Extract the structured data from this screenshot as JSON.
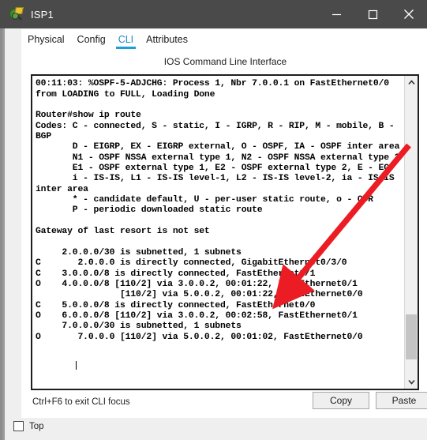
{
  "window": {
    "title": "ISP1",
    "icon": "packet-tracer-device-icon",
    "controls": {
      "minimize": "minimize-icon",
      "maximize": "maximize-icon",
      "close": "close-icon"
    }
  },
  "tabs": [
    {
      "label": "Physical",
      "active": false
    },
    {
      "label": "Config",
      "active": false
    },
    {
      "label": "CLI",
      "active": true
    },
    {
      "label": "Attributes",
      "active": false
    }
  ],
  "panel": {
    "title": "IOS Command Line Interface"
  },
  "terminal": {
    "text": "Router#\n00:11:03: %OSPF-5-ADJCHG: Process 1, Nbr 7.0.0.1 on FastEthernet0/0\nfrom LOADING to FULL, Loading Done\n\nRouter#show ip route\nCodes: C - connected, S - static, I - IGRP, R - RIP, M - mobile, B -\nBGP\n       D - EIGRP, EX - EIGRP external, O - OSPF, IA - OSPF inter area\n       N1 - OSPF NSSA external type 1, N2 - OSPF NSSA external type 2\n       E1 - OSPF external type 1, E2 - OSPF external type 2, E - EGP\n       i - IS-IS, L1 - IS-IS level-1, L2 - IS-IS level-2, ia - IS-IS\ninter area\n       * - candidate default, U - per-user static route, o - ODR\n       P - periodic downloaded static route\n\nGateway of last resort is not set\n\n     2.0.0.0/30 is subnetted, 1 subnets\nC       2.0.0.0 is directly connected, GigabitEthernet0/3/0\nC    3.0.0.0/8 is directly connected, FastEthernet0/1\nO    4.0.0.0/8 [110/2] via 3.0.0.2, 00:01:22, FastEthernet0/1\n                [110/2] via 5.0.0.2, 00:01:22, FastEthernet0/0\nC    5.0.0.0/8 is directly connected, FastEthernet0/0\nO    6.0.0.0/8 [110/2] via 3.0.0.2, 00:02:58, FastEthernet0/1\n     7.0.0.0/30 is subnetted, 1 subnets\nO       7.0.0.0 [110/2] via 5.0.0.2, 00:01:02, FastEthernet0/0\n",
    "prompt": "Router#",
    "scrollbar": {
      "up_icon": "chevron-up-icon",
      "down_icon": "chevron-down-icon"
    }
  },
  "footer": {
    "hint": "Ctrl+F6 to exit CLI focus",
    "copy_label": "Copy",
    "paste_label": "Paste"
  },
  "top_option": {
    "label": "Top",
    "checked": false
  },
  "annotation": {
    "arrow_color": "#ec1c24",
    "target_text": "FastEthernet0/1"
  }
}
